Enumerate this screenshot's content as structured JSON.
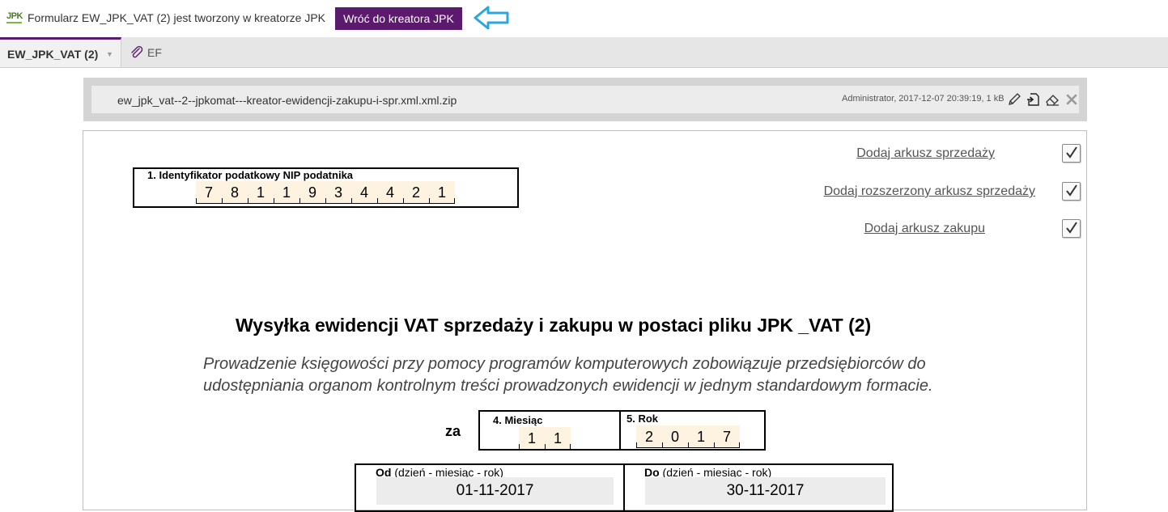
{
  "topbar": {
    "logo_text": "JPK",
    "title": "Formularz EW_JPK_VAT (2) jest tworzony w kreatorze JPK",
    "back_button": "Wróć do kreatora JPK",
    "arrow_icon": "arrow-left-outline-icon",
    "accent_color": "#5c1a6e"
  },
  "tabs": [
    {
      "label": "EW_JPK_VAT (2)",
      "active": true,
      "has_dropdown": true
    },
    {
      "label": "EF",
      "icon": "paperclip-icon",
      "active": false
    }
  ],
  "attachment": {
    "filename": "ew_jpk_vat--2--jpkomat---kreator-ewidencji-zakupu-i-spr.xml.xml.zip",
    "meta": "Administrator, 2017-12-07 20:39:19, 1 kB",
    "actions": [
      "pencil-icon",
      "download-icon",
      "eraser-icon",
      "close-icon"
    ]
  },
  "form": {
    "nip": {
      "label": "1. Identyfikator podatkowy NIP podatnika",
      "digits": [
        "7",
        "8",
        "1",
        "1",
        "9",
        "3",
        "4",
        "4",
        "2",
        "1"
      ]
    },
    "links": [
      {
        "label": "Dodaj arkusz sprzedaży",
        "checked": true
      },
      {
        "label": "Dodaj rozszerzony arkusz sprzedaży",
        "checked": true
      },
      {
        "label": "Dodaj arkusz zakupu",
        "checked": true
      }
    ],
    "heading": "Wysyłka ewidencji VAT sprzedaży i zakupu w postaci pliku JPK _VAT (2)",
    "description": "Prowadzenie księgowości przy pomocy programów komputerowych zobowiązuje przedsiębiorców do udostępniania organom kontrolnym treści prowadzonych ewidencji w jednym standardowym formacie.",
    "za_label": "za",
    "month": {
      "label": "4. Miesiąc",
      "digits": [
        "1",
        "1"
      ]
    },
    "year": {
      "label": "5. Rok",
      "digits": [
        "2",
        "0",
        "1",
        "7"
      ]
    },
    "from": {
      "label_bold": "Od",
      "label_rest": " (dzień - miesiąc - rok)",
      "value": "01-11-2017"
    },
    "to": {
      "label_bold": "Do",
      "label_rest": " (dzień - miesiąc - rok)",
      "value": "30-11-2017"
    }
  }
}
